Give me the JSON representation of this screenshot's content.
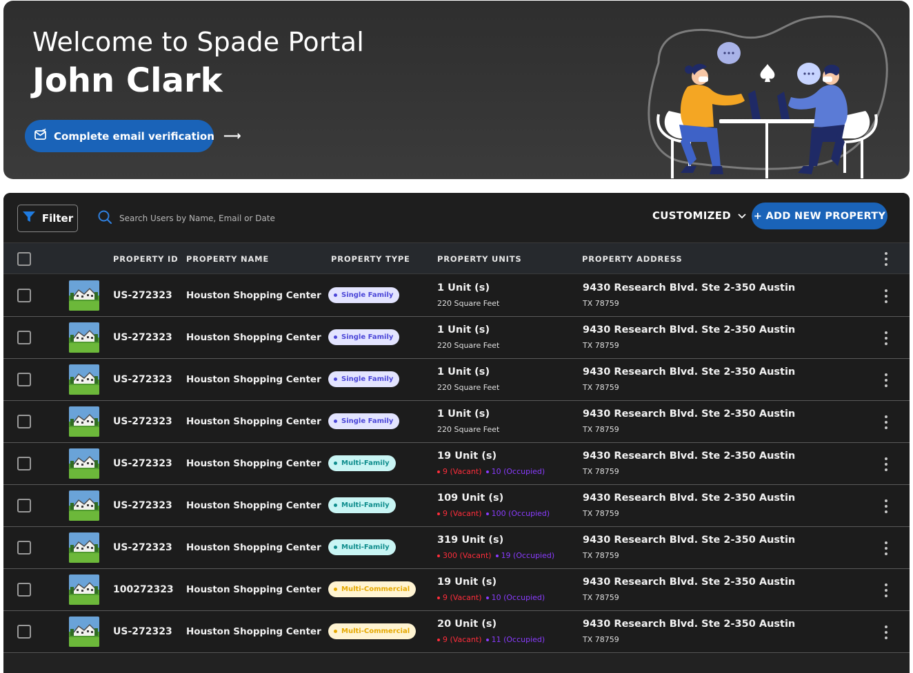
{
  "hero": {
    "welcome": "Welcome to Spade Portal",
    "user_name": "John Clark",
    "verify_label": "Complete email verification",
    "verify_arrow": "⟶"
  },
  "toolbar": {
    "filter_label": "Filter",
    "search_placeholder": "Search Users by Name, Email or Date",
    "view_label": "CUSTOMIZED",
    "add_label": "+ ADD NEW PROPERTY"
  },
  "table": {
    "columns": [
      "PROPERTY ID",
      "PROPERTY NAME",
      "PROPERTY TYPE",
      "PROPERTY UNITS",
      "PROPERTY ADDRESS"
    ],
    "rows": [
      {
        "id": "US-272323",
        "name": "Houston Shopping Center",
        "type": "Single Family",
        "type_kind": "single",
        "units": "1 Unit (s)",
        "units_sub": "220 Square Feet",
        "vacant": "",
        "occupied": "",
        "addr1": "9430 Research Blvd. Ste 2-350 Austin",
        "addr2": "TX 78759"
      },
      {
        "id": "US-272323",
        "name": "Houston Shopping Center",
        "type": "Single Family",
        "type_kind": "single",
        "units": "1 Unit (s)",
        "units_sub": "220 Square Feet",
        "vacant": "",
        "occupied": "",
        "addr1": "9430 Research Blvd. Ste 2-350 Austin",
        "addr2": "TX 78759"
      },
      {
        "id": "US-272323",
        "name": "Houston Shopping Center",
        "type": "Single Family",
        "type_kind": "single",
        "units": "1 Unit (s)",
        "units_sub": "220 Square Feet",
        "vacant": "",
        "occupied": "",
        "addr1": "9430 Research Blvd. Ste 2-350 Austin",
        "addr2": "TX 78759"
      },
      {
        "id": "US-272323",
        "name": "Houston Shopping Center",
        "type": "Single Family",
        "type_kind": "single",
        "units": "1 Unit (s)",
        "units_sub": "220 Square Feet",
        "vacant": "",
        "occupied": "",
        "addr1": "9430 Research Blvd. Ste 2-350 Austin",
        "addr2": "TX 78759"
      },
      {
        "id": "US-272323",
        "name": "Houston Shopping Center",
        "type": "Multi-Family",
        "type_kind": "multi",
        "units": "19 Unit (s)",
        "units_sub": "",
        "vacant": "9 (Vacant)",
        "occupied": "10 (Occupied)",
        "addr1": "9430 Research Blvd. Ste 2-350 Austin",
        "addr2": "TX 78759"
      },
      {
        "id": "US-272323",
        "name": "Houston Shopping Center",
        "type": "Multi-Family",
        "type_kind": "multi",
        "units": "109 Unit (s)",
        "units_sub": "",
        "vacant": "9 (Vacant)",
        "occupied": "100 (Occupied)",
        "addr1": "9430 Research Blvd. Ste 2-350 Austin",
        "addr2": "TX 78759"
      },
      {
        "id": "US-272323",
        "name": "Houston Shopping Center",
        "type": "Multi-Family",
        "type_kind": "multi",
        "units": "319 Unit (s)",
        "units_sub": "",
        "vacant": "300 (Vacant)",
        "occupied": "19 (Occupied)",
        "addr1": "9430 Research Blvd. Ste 2-350 Austin",
        "addr2": "TX 78759"
      },
      {
        "id": "100272323",
        "name": "Houston Shopping Center",
        "type": "Multi-Commercial",
        "type_kind": "commercial",
        "units": "19 Unit (s)",
        "units_sub": "",
        "vacant": "9 (Vacant)",
        "occupied": "10 (Occupied)",
        "addr1": "9430 Research Blvd. Ste 2-350 Austin",
        "addr2": "TX 78759"
      },
      {
        "id": "US-272323",
        "name": "Houston Shopping Center",
        "type": "Multi-Commercial",
        "type_kind": "commercial",
        "units": "20 Unit (s)",
        "units_sub": "",
        "vacant": "9 (Vacant)",
        "occupied": "11 (Occupied)",
        "addr1": "9430 Research Blvd. Ste 2-350 Austin",
        "addr2": "TX 78759"
      }
    ]
  },
  "colors": {
    "accent": "#1a63b8",
    "vacant": "#ff2d3b",
    "occupied": "#8a3cff"
  }
}
